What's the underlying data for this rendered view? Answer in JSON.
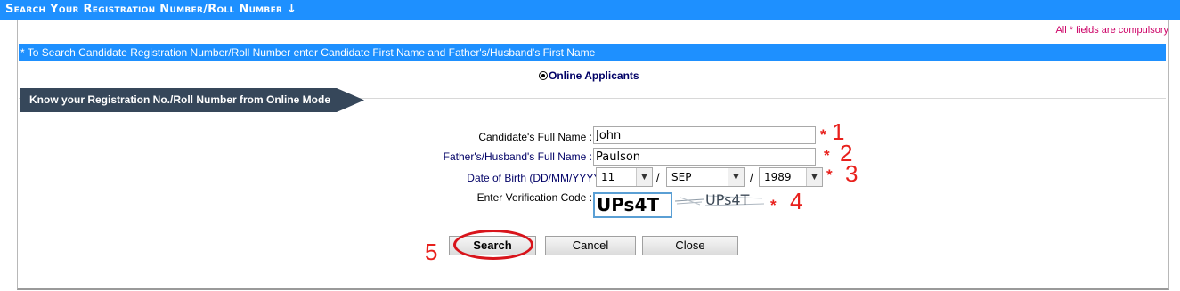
{
  "header": {
    "title": "Search Your Registration Number/Roll Number ↓"
  },
  "note": {
    "compulsory": "All * fields are compulsory"
  },
  "info": {
    "text": "* To Search Candidate Registration Number/Roll Number enter Candidate First Name and Father's/Husband's First Name"
  },
  "mode": {
    "label": "Online Applicants",
    "selected": true
  },
  "banner": {
    "text": "Know your Registration No./Roll Number from Online Mode"
  },
  "form": {
    "full_name_label": "Candidate's Full Name :",
    "full_name_value": "John",
    "father_label": "Father's/Husband's Full Name :",
    "father_value": "Paulson",
    "dob_label": "Date of Birth (DD/MM/YYYY) :",
    "dob_day": "11",
    "dob_month": "SEP",
    "dob_year": "1989",
    "dob_sep": "/",
    "code_label": "Enter Verification Code :",
    "code_value": "UPs4T",
    "captcha_text": "UPs4T",
    "required_mark": "*"
  },
  "annotations": {
    "n1": "1",
    "n2": "2",
    "n3": "3",
    "n4": "4",
    "n5": "5",
    "color": "#e8201c"
  },
  "buttons": {
    "search": "Search",
    "cancel": "Cancel",
    "close": "Close"
  },
  "colors": {
    "header_bg": "#1e90ff",
    "banner_bg": "#36475a",
    "required": "#e8201c",
    "compulsory_text": "#cc0066"
  }
}
